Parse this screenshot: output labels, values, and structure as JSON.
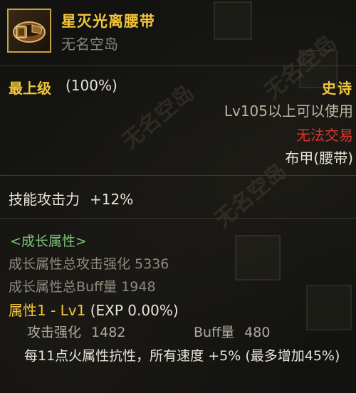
{
  "item": {
    "name": "星灭光离腰带",
    "subtitle": "无名空岛",
    "icon": "belt-icon"
  },
  "grade": {
    "label": "最上级",
    "percent": "(100%)"
  },
  "rarity": "史诗",
  "level_requirement": "Lv105以上可以使用",
  "trade_status": "无法交易",
  "equipment_type": "布甲(腰带)",
  "stat": {
    "label": "技能攻击力",
    "value": "+12%"
  },
  "growth": {
    "title": "<成长属性>",
    "total_attack_enhance": "成长属性总攻击强化 5336",
    "total_buff": "成长属性总Buff量 1948"
  },
  "attribute1": {
    "name": "属性1",
    "level": "- Lv1",
    "exp": "(EXP 0.00%)",
    "attack_enhance_label": "攻击强化",
    "attack_enhance_value": "1482",
    "buff_label": "Buff量",
    "buff_value": "480",
    "effect": "每11点火属性抗性，所有速度 +5% (最多增加45%)"
  },
  "watermark": "无名空岛",
  "colors": {
    "gold": "#f3c53a",
    "red": "#e0342a",
    "green": "#7ec27a",
    "border": "#c9a248"
  }
}
